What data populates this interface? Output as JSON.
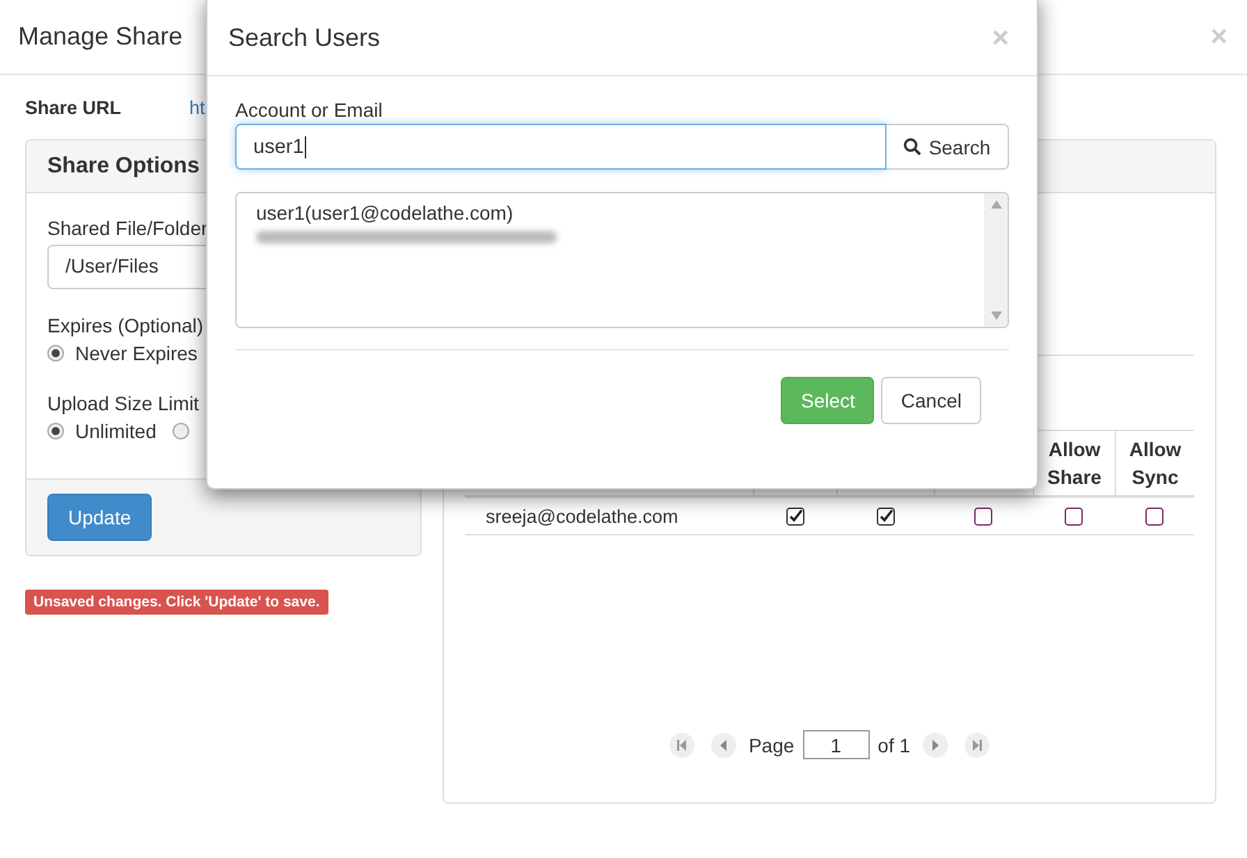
{
  "page": {
    "title": "Manage Share",
    "close": "×"
  },
  "share_url": {
    "label": "Share URL",
    "value": "ht"
  },
  "share_options": {
    "title": "Share Options",
    "shared_path": {
      "label": "Shared File/Folder",
      "value": "/User/Files"
    },
    "expires": {
      "label": "Expires (Optional)",
      "options": [
        {
          "label": "Never Expires",
          "selected": true
        }
      ]
    },
    "upload_limit": {
      "label": "Upload Size Limit",
      "options": [
        {
          "label": "Unlimited",
          "selected": true
        },
        {
          "selected": false
        }
      ]
    },
    "update_button": "Update"
  },
  "warning": "Unsaved changes. Click 'Update' to save.",
  "users_table": {
    "columns": [
      "Allow Share",
      "Allow Sync"
    ],
    "rows": [
      {
        "email": "sreeja@codelathe.com",
        "permissions": [
          {
            "checked": true
          },
          {
            "checked": true
          },
          {
            "checked": false
          },
          {
            "checked": false
          },
          {
            "checked": false
          }
        ]
      }
    ],
    "pager": {
      "label": "Page",
      "page": "1",
      "of": "of 1"
    }
  },
  "dialog": {
    "title": "Search Users",
    "close": "×",
    "field_label": "Account or Email",
    "field_value": "user1",
    "search_button": "Search",
    "results": [
      {
        "kind": "text",
        "text": "user1(user1@codelathe.com)"
      },
      {
        "kind": "redacted"
      }
    ],
    "buttons": [
      {
        "label": "Select",
        "kind": "primary"
      },
      {
        "label": "Cancel",
        "kind": "default"
      }
    ]
  }
}
